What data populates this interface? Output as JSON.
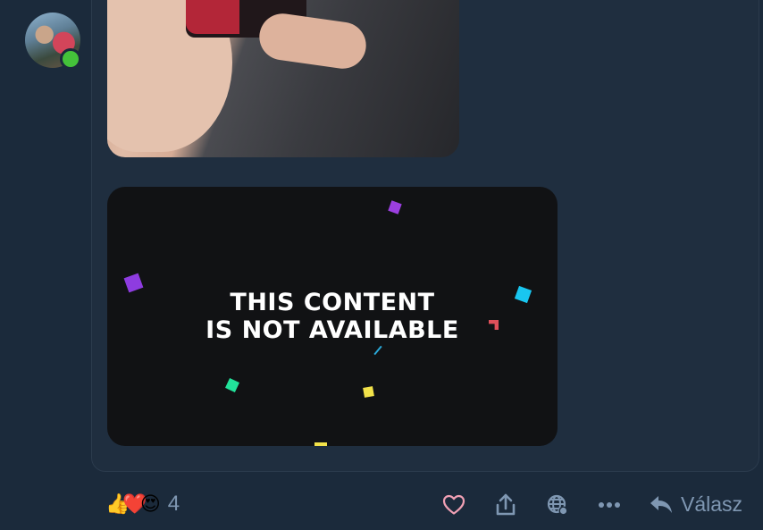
{
  "post": {
    "media_message": "THIS CONTENT\nIS NOT AVAILABLE"
  },
  "footer": {
    "reaction_emojis": [
      "👍",
      "❤️",
      "😍"
    ],
    "reaction_count": "4",
    "reply_label": "Válasz"
  },
  "colors": {
    "background": "#1b2a3b",
    "card": "#1f2e3f",
    "accent_like": "#f0a0b4",
    "muted": "#7f97b2",
    "presence": "#44c23a"
  },
  "icons": [
    "heart-icon",
    "share-icon",
    "globe-icon",
    "more-icon",
    "reply-icon"
  ]
}
